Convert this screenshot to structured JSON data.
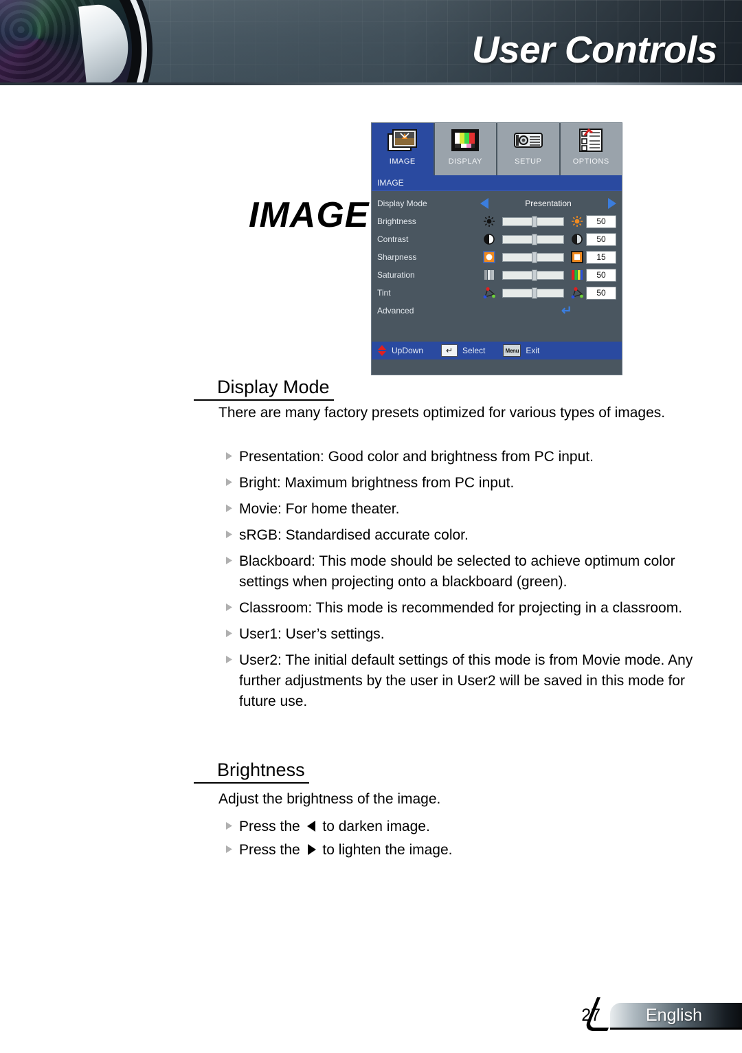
{
  "header": {
    "title": "User Controls",
    "lens_icon": "camera-lens-graphic"
  },
  "section_word": "IMAGE",
  "osd": {
    "tabs": [
      {
        "label": "IMAGE",
        "icon": "picture-icon",
        "active": true
      },
      {
        "label": "DISPLAY",
        "icon": "color-bars-icon",
        "active": false
      },
      {
        "label": "SETUP",
        "icon": "projector-icon",
        "active": false
      },
      {
        "label": "OPTIONS",
        "icon": "checklist-icon",
        "active": false
      }
    ],
    "title": "IMAGE",
    "rows": [
      {
        "label": "Display Mode",
        "type": "choice",
        "value": "Presentation"
      },
      {
        "label": "Brightness",
        "type": "slider",
        "value": "50",
        "percent": 50,
        "icon_left": "sun-small-icon",
        "icon_right": "sun-bright-icon"
      },
      {
        "label": "Contrast",
        "type": "slider",
        "value": "50",
        "percent": 50,
        "icon_left": "contrast-dark-icon",
        "icon_right": "contrast-light-icon"
      },
      {
        "label": "Sharpness",
        "type": "slider",
        "value": "15",
        "percent": 50,
        "icon_left": "sharpness-soft-icon",
        "icon_right": "sharpness-hard-icon"
      },
      {
        "label": "Saturation",
        "type": "slider",
        "value": "50",
        "percent": 50,
        "icon_left": "saturation-gray-icon",
        "icon_right": "saturation-color-icon"
      },
      {
        "label": "Tint",
        "type": "slider",
        "value": "50",
        "percent": 50,
        "icon_left": "tint-icon",
        "icon_right": "tint-color-icon"
      },
      {
        "label": "Advanced",
        "type": "enter",
        "value": ""
      }
    ],
    "footer": [
      {
        "icon": "up-down-arrows-icon",
        "label": "UpDown"
      },
      {
        "icon": "enter-key-icon",
        "label": "Select",
        "key": "↵"
      },
      {
        "icon": "menu-key-icon",
        "label": "Exit",
        "key": "Menu"
      }
    ]
  },
  "sections": [
    {
      "heading": "Display Mode",
      "intro": "There are many factory presets optimized for various types of images.",
      "bullets": [
        "Presentation: Good color and brightness from PC input.",
        "Bright: Maximum brightness from PC input.",
        "Movie: For home theater.",
        "sRGB: Standardised accurate color.",
        "Blackboard: This mode should be selected to achieve optimum color settings when projecting onto a blackboard (green).",
        "Classroom: This mode is recommended for projecting in a classroom.",
        "User1: User’s settings.",
        "User2: The initial default settings of this mode is from Movie mode. Any further adjustments by the user in User2 will be saved in this mode for future use."
      ]
    },
    {
      "heading": "Brightness",
      "intro": "Adjust the brightness of the image.",
      "bullets_split": [
        {
          "pre": "Press the ",
          "arrow": "left-triangle-icon",
          "post": " to darken image."
        },
        {
          "pre": "Press the ",
          "arrow": "right-triangle-icon",
          "post": " to lighten the image."
        }
      ]
    }
  ],
  "footer": {
    "page_number": "27",
    "language": "English"
  },
  "colors": {
    "osd_tab_active": "#2a4aa0",
    "osd_tab_inactive": "#9aa3ab",
    "osd_body": "#4a5660",
    "osd_arrow": "#3b7ddd",
    "header_bg": "#4e5f6a"
  }
}
